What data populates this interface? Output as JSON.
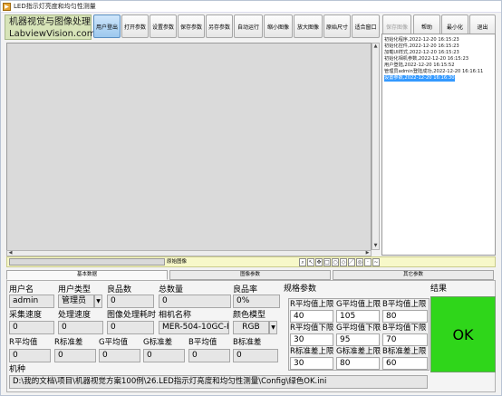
{
  "window": {
    "title": "LED指示灯亮度和均匀性测量",
    "app_icon": "labview-app-icon"
  },
  "brand": {
    "line1": "机器视觉与图像处理",
    "line2": "LabviewVision.com"
  },
  "toolbar": {
    "user_login": "用户登出",
    "open_params": "打开参数",
    "set_params": "设置参数",
    "save_params": "保存参数",
    "save_as_params": "另存参数",
    "auto_run": "自动运行",
    "zoom_out": "缩小图像",
    "zoom_in": "放大图像",
    "original_size": "原始尺寸",
    "fit_window": "适合窗口",
    "save_image": "保存图像",
    "help": "帮助",
    "minimize": "最小化",
    "exit": "退出"
  },
  "log": [
    "初始化程序,2022-12-20 16:15:23",
    "初始化控件,2022-12-20 16:15:23",
    "加载UI样式,2022-12-20 16:15:23",
    "初始化相机参数,2022-12-20 16:15:23",
    "用户登陆,2022-12-20 16:15:52",
    "管理员admin登陆成功,2022-12-20 16:16:11",
    "设置参数,2022-12-20 16:16:30"
  ],
  "image_strip": {
    "label": "原始图像",
    "path_value": ""
  },
  "tabs": [
    "基本数据",
    "图像参数",
    "其它参数"
  ],
  "basic": {
    "username_label": "用户名",
    "username": "admin",
    "usertype_label": "用户类型",
    "usertype": "管理员",
    "good_label": "良品数",
    "good": "0",
    "total_label": "总数量",
    "total": "0",
    "yield_label": "良品率",
    "yield": "0%",
    "capture_speed_label": "采集速度",
    "capture_speed": "0",
    "process_speed_label": "处理速度",
    "process_speed": "0",
    "process_time_label": "图像处理耗时",
    "process_time": "0",
    "camera_label": "相机名称",
    "camera": "MER-504-10GC-P",
    "color_label": "颜色模型",
    "color": "RGB",
    "r_mean_label": "R平均值",
    "r_mean": "0",
    "r_std_label": "R标准差",
    "r_std": "0",
    "g_mean_label": "G平均值",
    "g_mean": "0",
    "g_std_label": "G标准差",
    "g_std": "0",
    "b_mean_label": "B平均值",
    "b_mean": "0",
    "b_std_label": "B标准差",
    "b_std": "0",
    "model_label": "机种",
    "model_path": "D:\\我的文档\\项目\\机器视觉方案100例\\26.LED指示灯亮度和均匀性测量\\Config\\绿色OK.ini"
  },
  "spec": {
    "title": "规格参数",
    "h1": [
      "R平均值上限",
      "G平均值上限",
      "B平均值上限"
    ],
    "v1": [
      "40",
      "105",
      "80"
    ],
    "h2": [
      "R平均值下限",
      "G平均值下限",
      "B平均值下限"
    ],
    "v2": [
      "30",
      "95",
      "70"
    ],
    "h3": [
      "R标准差上限",
      "G标准差上限",
      "B标准差上限"
    ],
    "v3": [
      "30",
      "80",
      "60"
    ]
  },
  "result": {
    "title": "结果",
    "value": "OK",
    "color": "#2fd61a"
  }
}
